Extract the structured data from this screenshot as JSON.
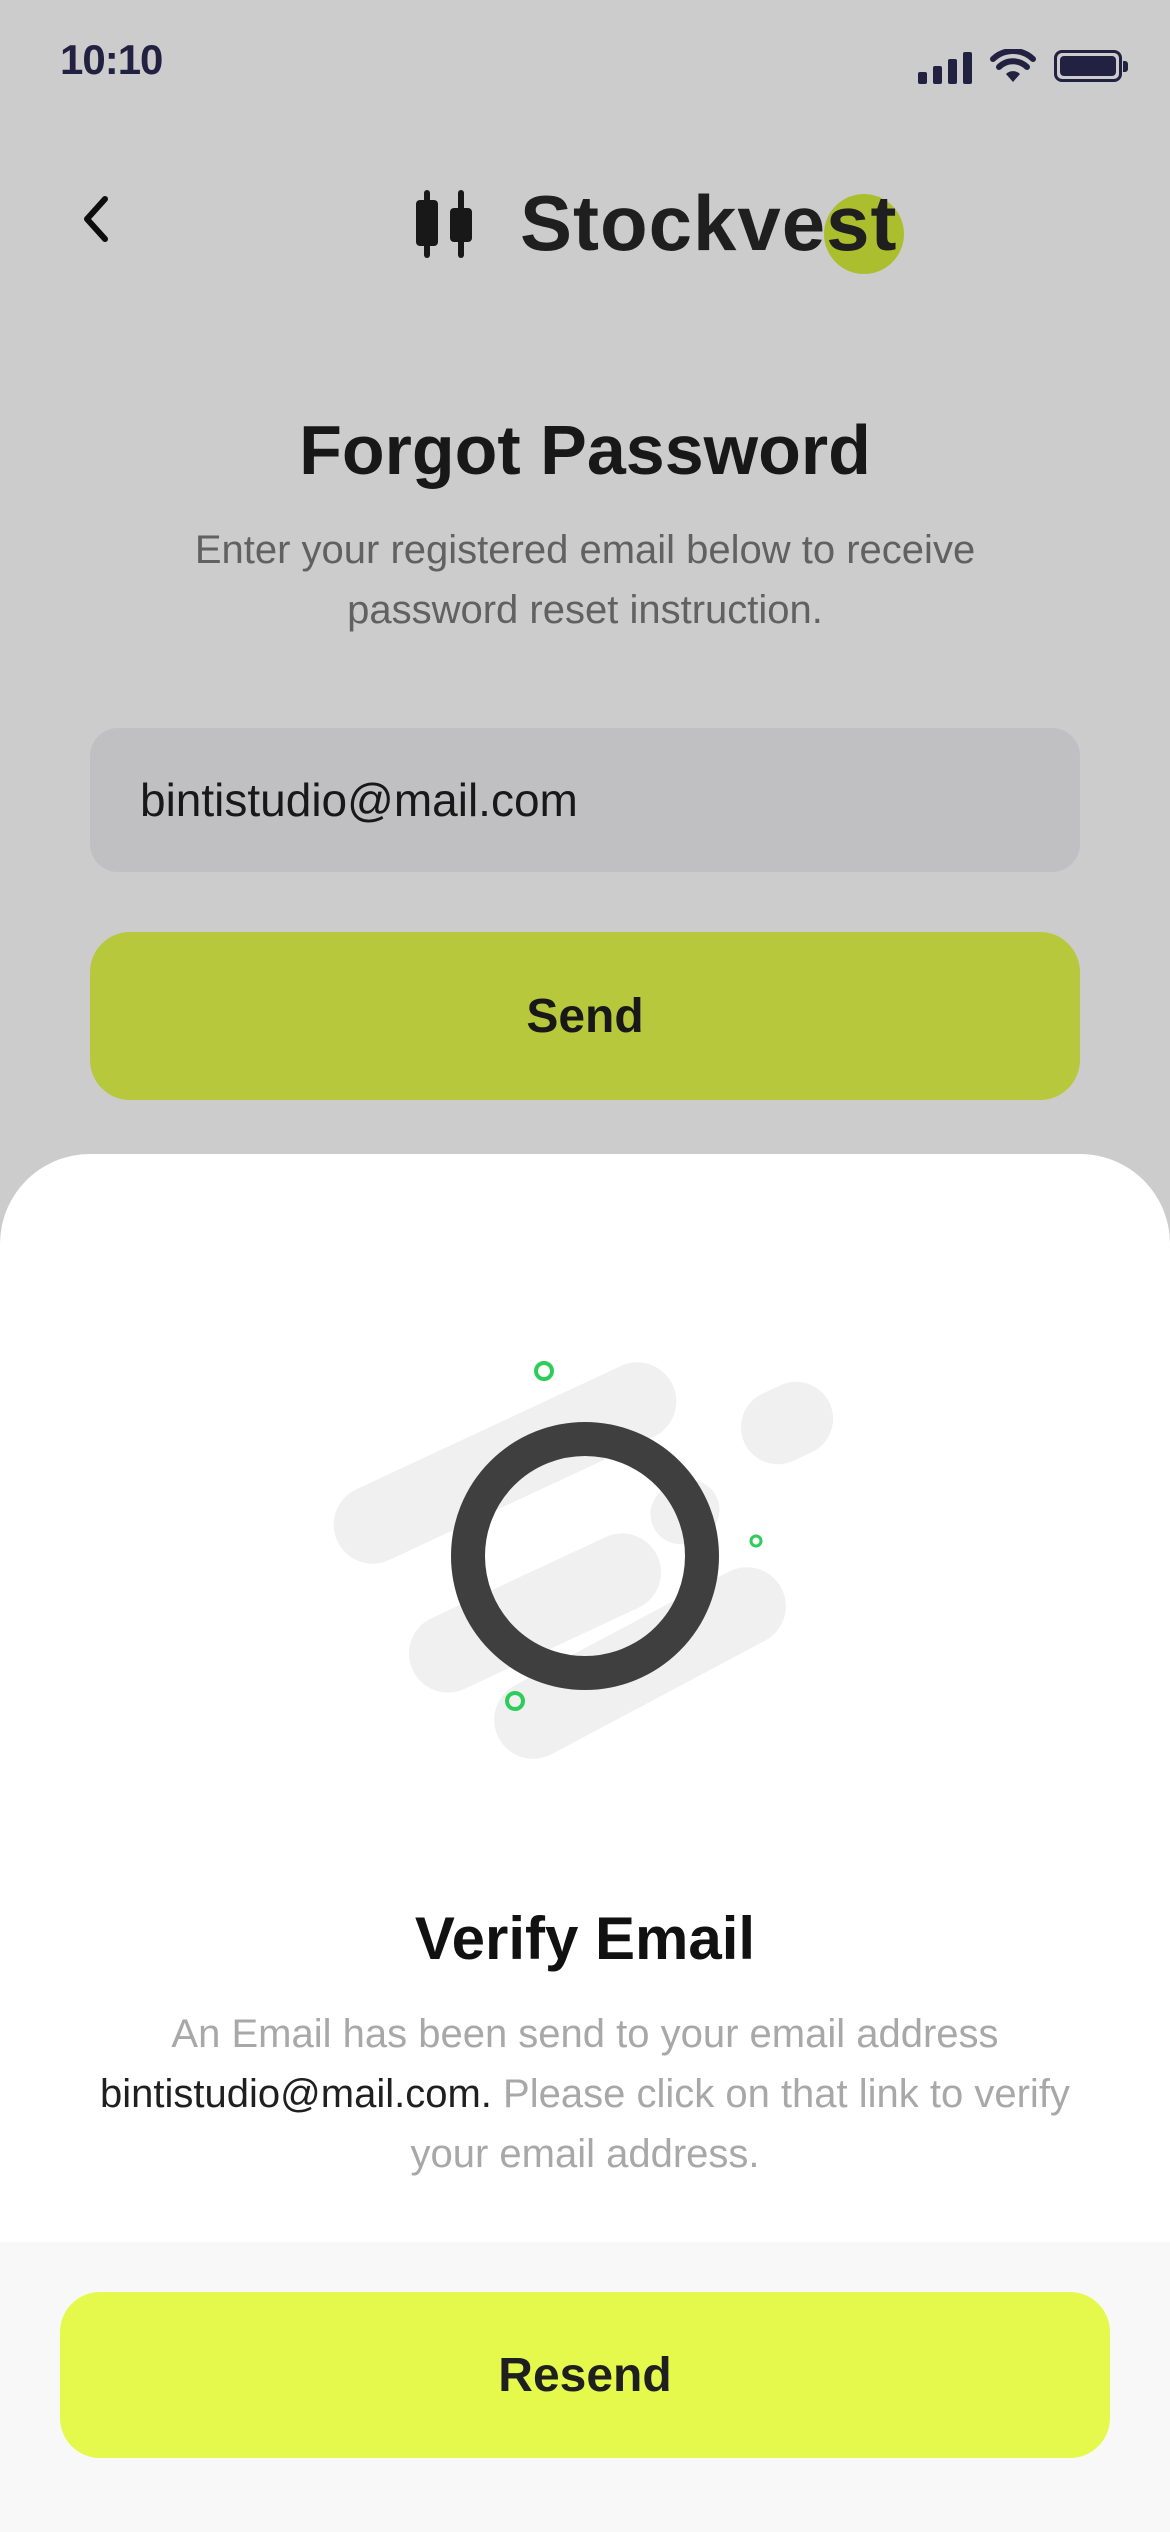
{
  "status_bar": {
    "time": "10:10"
  },
  "header": {
    "logo_text": "Stockvest"
  },
  "forgot": {
    "title": "Forgot Password",
    "subtitle": "Enter your registered email below to receive password reset instruction.",
    "email_value": "bintistudio@mail.com",
    "send_label": "Send"
  },
  "sheet": {
    "title": "Verify Email",
    "text_before": "An Email has been send to your email address ",
    "email": "bintistudio@mail.com.",
    "text_after": " Please click on that link to verify your email address.",
    "resend_label": "Resend"
  },
  "icons": {
    "back": "chevron-left-icon",
    "logo": "candlestick-icon",
    "signal": "signal-icon",
    "wifi": "wifi-icon",
    "battery": "battery-icon"
  },
  "colors": {
    "accent": "#e4f94b",
    "overlay": "rgba(0,0,0,0.2)",
    "ring": "#3f3f3f",
    "spark": "#2ecc5b",
    "status": "#2b2a52"
  }
}
